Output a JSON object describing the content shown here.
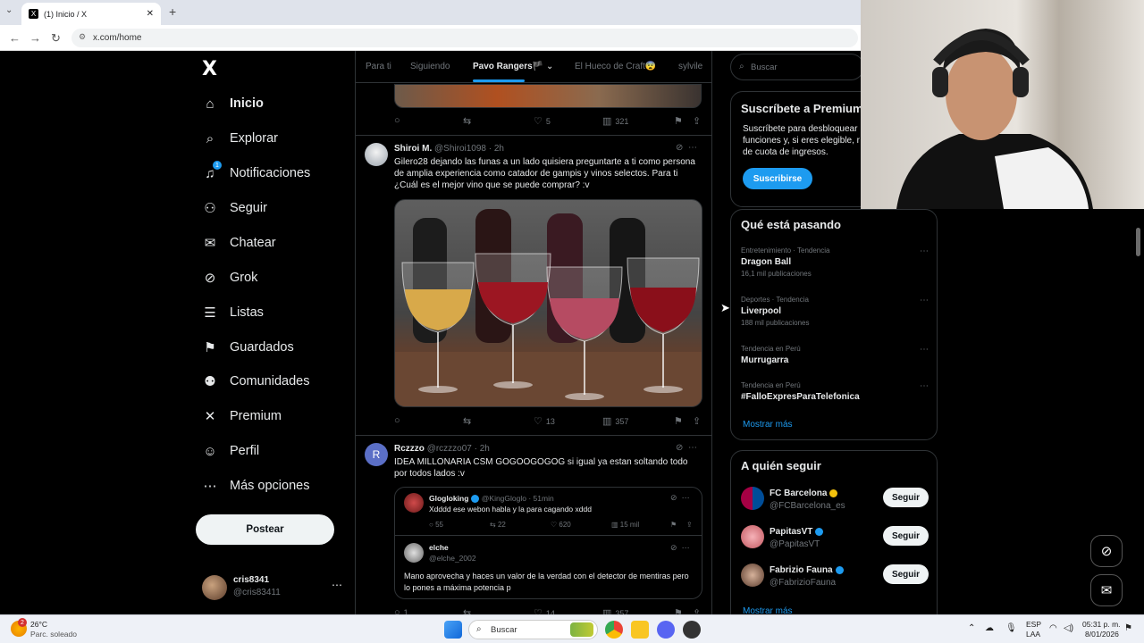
{
  "browser": {
    "tab_title": "(1) Inicio / X",
    "url": "x.com/home"
  },
  "sidebar": {
    "logo": "X",
    "items": [
      {
        "label": "Inicio"
      },
      {
        "label": "Explorar"
      },
      {
        "label": "Notificaciones",
        "badge": "1"
      },
      {
        "label": "Seguir"
      },
      {
        "label": "Chatear"
      },
      {
        "label": "Grok"
      },
      {
        "label": "Listas"
      },
      {
        "label": "Guardados"
      },
      {
        "label": "Comunidades"
      },
      {
        "label": "Premium"
      },
      {
        "label": "Perfil"
      },
      {
        "label": "Más opciones"
      }
    ],
    "post_button": "Postear",
    "account": {
      "name": "cris8341",
      "handle": "@cris83411"
    }
  },
  "feed": {
    "tabs": [
      "Para ti",
      "Siguiendo",
      "Pavo Rangers🏴",
      "El Hueco de Craft😨",
      "sylvile"
    ],
    "active_tab": "Pavo Rangers🏴",
    "prev_tweet_stats": {
      "likes": "5",
      "views": "321"
    },
    "tweets": [
      {
        "name": "Shiroi M.",
        "handle": "@Shiroi1098",
        "time": "· 2h",
        "text": "Gilero28 dejando las funas a un lado quisiera preguntarte a ti como persona de amplia experiencia como catador de gampis y vinos selectos. Para ti ¿Cuál es el mejor vino que se puede comprar? :v",
        "likes": "13",
        "views": "357"
      },
      {
        "name": "Rczzzo",
        "handle": "@rczzzo07",
        "time": "· 2h",
        "avatar_letter": "R",
        "text": "IDEA MILLONARIA CSM GOGOOGOGOG si igual ya estan soltando todo por todos lados :v",
        "quote": {
          "name": "Glogloking",
          "handle": "@KingGloglo",
          "time": "· 51min",
          "text": "Xdddd ese webon habla y la para cagando xddd",
          "replies": "55",
          "retweets": "22",
          "likes": "620",
          "views": "15 mil",
          "reply_name": "elche",
          "reply_handle": "@elche_2002",
          "reply_text": "Mano aprovecha y haces un valor de la verdad con el detector de mentiras pero lo pones a máxima potencia p"
        },
        "replies": "1",
        "likes": "14",
        "views": "357"
      }
    ]
  },
  "right": {
    "search_placeholder": "Buscar",
    "premium": {
      "title": "Suscríbete a Premium",
      "desc": "Suscríbete para desbloquear funciones y, si eres elegible, r de cuota de ingresos.",
      "button": "Suscribirse"
    },
    "trends_title": "Qué está pasando",
    "trends": [
      {
        "meta": "Entretenimiento · Tendencia",
        "title": "Dragon Ball",
        "count": "16,1 mil publicaciones"
      },
      {
        "meta": "Deportes · Tendencia",
        "title": "Liverpool",
        "count": "188 mil publicaciones"
      },
      {
        "meta": "Tendencia en Perú",
        "title": "Murrugarra",
        "count": ""
      },
      {
        "meta": "Tendencia en Perú",
        "title": "#FalloExpresParaTelefonica",
        "count": ""
      }
    ],
    "show_more": "Mostrar más",
    "who_title": "A quién seguir",
    "follow": [
      {
        "name": "FC Barcelona",
        "handle": "@FCBarcelona_es",
        "button": "Seguir"
      },
      {
        "name": "PapitasVT",
        "handle": "@PapitasVT",
        "button": "Seguir"
      },
      {
        "name": "Fabrizio Fauna",
        "handle": "@FabrizioFauna",
        "button": "Seguir"
      }
    ],
    "show_more_2": "Mostrar más"
  },
  "taskbar": {
    "weather_temp": "26°C",
    "weather_desc": "Parc. soleado",
    "weather_badge": "2",
    "search": "Buscar",
    "lang1": "ESP",
    "lang2": "LAA",
    "time": "05:31 p. m.",
    "date": "8/01/2026"
  }
}
